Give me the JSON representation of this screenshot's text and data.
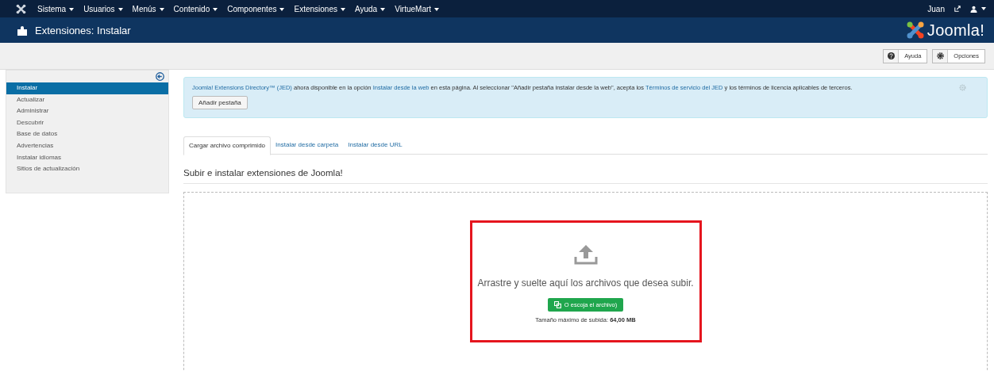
{
  "menu": {
    "items": [
      {
        "label": "Sistema",
        "caret": true
      },
      {
        "label": "Usuarios",
        "caret": true
      },
      {
        "label": "Menús",
        "caret": true
      },
      {
        "label": "Contenido",
        "caret": true
      },
      {
        "label": "Componentes",
        "caret": true
      },
      {
        "label": "Extensiones",
        "caret": true
      },
      {
        "label": "Ayuda",
        "caret": true
      },
      {
        "label": "VirtueMart",
        "caret": true
      }
    ],
    "user": "Juan"
  },
  "header": {
    "title": "Extensiones: Instalar",
    "logo": "Joomla!"
  },
  "toolbar": {
    "buttons": [
      {
        "label": "Ayuda",
        "kind": "help"
      },
      {
        "label": "Opciones",
        "kind": "options"
      }
    ]
  },
  "sidebar": {
    "items": [
      {
        "label": "Instalar",
        "selected": true
      },
      {
        "label": "Actualizar",
        "selected": false
      },
      {
        "label": "Administrar",
        "selected": false
      },
      {
        "label": "Descubrir",
        "selected": false
      },
      {
        "label": "Base de datos",
        "selected": false
      },
      {
        "label": "Advertencias",
        "selected": false
      },
      {
        "label": "Instalar idiomas",
        "selected": false
      },
      {
        "label": "Sitios de actualización",
        "selected": false
      }
    ]
  },
  "notice": {
    "segments": [
      {
        "kind": "link",
        "text": "Joomla! Extensions Directory™ (JED)"
      },
      {
        "kind": "text",
        "text": " ahora disponible en la opción "
      },
      {
        "kind": "link",
        "text": "Instalar desde la web"
      },
      {
        "kind": "text",
        "text": " en esta página. Al seleccionar \"Añadir pestaña instalar desde la web\", acepta los "
      },
      {
        "kind": "link",
        "text": "Términos de servicio del JED"
      },
      {
        "kind": "text",
        "text": " y los términos de licencia aplicables de terceros."
      }
    ],
    "button": "Añadir pestaña"
  },
  "tabs": [
    {
      "label": "Cargar archivo comprimido",
      "selected": true
    },
    {
      "label": "Instalar desde carpeta",
      "selected": false
    },
    {
      "label": "Instalar desde URL",
      "selected": false
    }
  ],
  "section_title": "Subir e instalar extensiones de Joomla!",
  "dropzone": {
    "message": "Arrastre y suelte aquí los archivos que desea subir.",
    "button": "O escoja el archivo)",
    "max_label": "Tamaño máximo de subida:",
    "max_value": "64,00 MB",
    "highlighted": true
  }
}
